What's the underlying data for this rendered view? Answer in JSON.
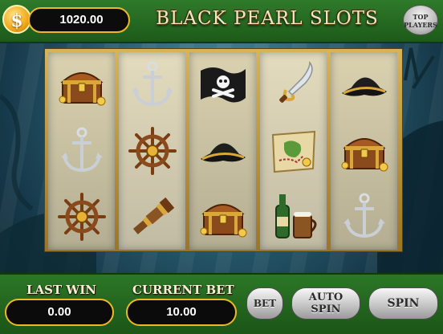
{
  "header": {
    "coin_symbol": "$",
    "balance": "1020.00",
    "title": "BLACK PEARL SLOTS",
    "top_players_line1": "TOP",
    "top_players_line2": "PLAYERS"
  },
  "reels": [
    [
      "treasure-chest",
      "anchor",
      "ship-wheel"
    ],
    [
      "anchor",
      "ship-wheel",
      "spyglass"
    ],
    [
      "pirate-flag",
      "pirate-hat",
      "treasure-chest"
    ],
    [
      "cutlass",
      "treasure-map",
      "rum-and-mug"
    ],
    [
      "pirate-hat",
      "treasure-chest",
      "anchor"
    ]
  ],
  "footer": {
    "last_win_label": "LAST WIN",
    "last_win_value": "0.00",
    "current_bet_label": "CURRENT BET",
    "current_bet_value": "10.00",
    "bet_button": "BET",
    "auto_spin_line1": "AUTO",
    "auto_spin_line2": "SPIN",
    "spin_button": "SPIN"
  },
  "colors": {
    "bar_green": "#2f7a2a",
    "gold_border": "#f0b72a",
    "reel_frame": "#c9a24a"
  }
}
